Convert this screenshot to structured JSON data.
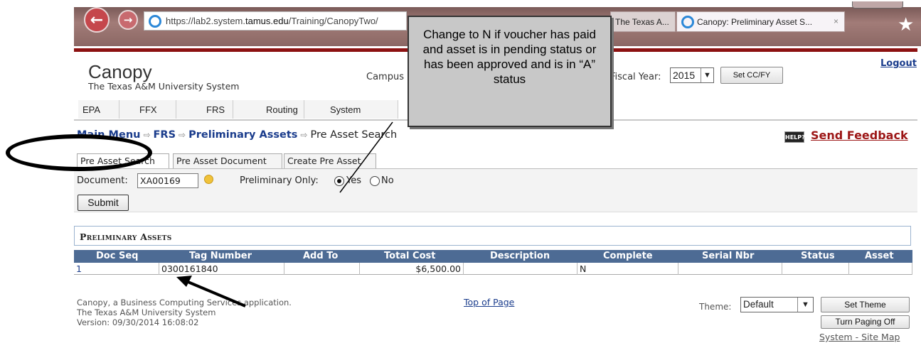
{
  "browser": {
    "url_prefix": "https://lab2.system.",
    "url_domain": "tamus.edu",
    "url_path": "/Training/CanopyTwo/",
    "tab_prev": "The Texas A...",
    "tab_current": "Canopy: Preliminary Asset S...",
    "tab_close": "×"
  },
  "header": {
    "app_name": "Canopy",
    "org": "The Texas A&M University System",
    "campus_label": "Campus",
    "fiscal_label": "Fiscal Year:",
    "fiscal_value": "2015",
    "set_cofy": "Set CC/FY",
    "logout": "Logout"
  },
  "menu": [
    "EPA",
    "FFX",
    "FRS",
    "Routing",
    "System"
  ],
  "breadcrumb": {
    "main_menu": "Main Menu",
    "frs": "FRS",
    "prelim": "Preliminary Assets",
    "current": "Pre Asset Search"
  },
  "help_label": "HELP?",
  "feedback": "Send Feedback",
  "subtabs": [
    "Pre Asset Search",
    "Pre Asset Document",
    "Create Pre Asset"
  ],
  "search": {
    "document_label": "Document:",
    "document_value": "XA00169",
    "prelim_label": "Preliminary Only:",
    "yes": "Yes",
    "no": "No",
    "submit": "Submit"
  },
  "results": {
    "title": "Preliminary Assets",
    "columns": [
      "Doc Seq",
      "Tag Number",
      "Add To",
      "Total Cost",
      "Description",
      "Complete",
      "Serial Nbr",
      "Status",
      "Asset"
    ],
    "rows": [
      {
        "doc_seq": "1",
        "tag_number": "0300161840",
        "add_to": "",
        "total_cost": "$6,500.00",
        "description": "",
        "complete": "N",
        "serial_nbr": "",
        "status": "",
        "asset": ""
      }
    ]
  },
  "footer": {
    "line1": "Canopy, a Business Computing Services application.",
    "line2": "The Texas A&M University System",
    "line3": "Version: 09/30/2014 16:08:02",
    "top_of_page": "Top of Page",
    "theme_label": "Theme:",
    "theme_value": "Default",
    "set_theme": "Set Theme",
    "paging": "Turn Paging Off",
    "sitemap": "System - Site Map"
  },
  "callout": {
    "text": "Change to N if voucher has paid and asset is in pending status or has been approved and is in “A” status"
  }
}
